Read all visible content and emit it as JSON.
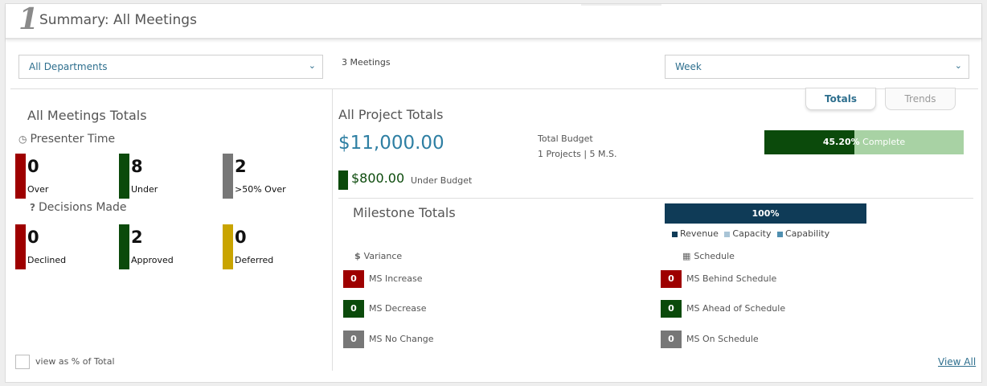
{
  "header": {
    "number": "1",
    "title": "Summary: All Meetings"
  },
  "filters": {
    "department": "All Departments",
    "meetings_count": "3 Meetings",
    "period": "Week"
  },
  "left": {
    "title": "All Meetings Totals",
    "presenter_time": {
      "label": "Presenter Time",
      "stats": [
        {
          "value": "0",
          "label": "Over",
          "color": "#9e0000"
        },
        {
          "value": "8",
          "label": "Under",
          "color": "#0b4a0b"
        },
        {
          "value": "2",
          "label": ">50% Over",
          "color": "#777777"
        }
      ]
    },
    "decisions": {
      "label": "Decisions Made",
      "stats": [
        {
          "value": "0",
          "label": "Declined",
          "color": "#9e0000"
        },
        {
          "value": "2",
          "label": "Approved",
          "color": "#0b4a0b"
        },
        {
          "value": "0",
          "label": "Deferred",
          "color": "#c9a400"
        }
      ]
    },
    "view_pct_label": "view as % of Total"
  },
  "tabs": {
    "totals": "Totals",
    "trends": "Trends"
  },
  "right": {
    "title": "All Project Totals",
    "total_amount": "$11,000.00",
    "budget_label": "Total Budget",
    "budget_sub": "1 Projects | 5 M.S.",
    "progress": {
      "value_text": "45.20%",
      "suffix": " Complete",
      "fraction": 0.452
    },
    "under_amount": "$800.00",
    "under_label": "Under Budget",
    "milestones": {
      "title": "Milestone Totals",
      "bar_label": "100%",
      "legend": [
        {
          "label": "Revenue",
          "color": "#0f3b57"
        },
        {
          "label": "Capacity",
          "color": "#a9c4d6"
        },
        {
          "label": "Capability",
          "color": "#4f8fb0"
        }
      ],
      "variance_label": "Variance",
      "schedule_label": "Schedule",
      "variance": [
        {
          "value": "0",
          "label": "MS Increase",
          "color": "#9e0000"
        },
        {
          "value": "0",
          "label": "MS Decrease",
          "color": "#0b4a0b"
        },
        {
          "value": "0",
          "label": "MS No Change",
          "color": "#777777"
        }
      ],
      "schedule": [
        {
          "value": "0",
          "label": "MS Behind Schedule",
          "color": "#9e0000"
        },
        {
          "value": "0",
          "label": "MS Ahead of Schedule",
          "color": "#0b4a0b"
        },
        {
          "value": "0",
          "label": "MS On Schedule",
          "color": "#777777"
        }
      ]
    },
    "view_all": "View All"
  }
}
